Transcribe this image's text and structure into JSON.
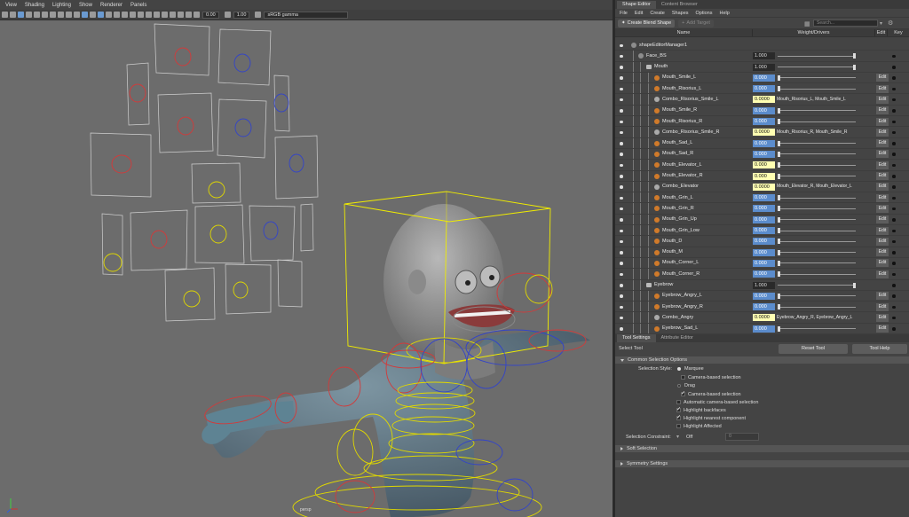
{
  "viewport": {
    "menu": [
      "View",
      "Shading",
      "Lighting",
      "Show",
      "Renderer",
      "Panels"
    ],
    "exposure": "0.00",
    "gamma": "1.00",
    "color_space": "sRGB gamma",
    "camera": "persp"
  },
  "shape_editor": {
    "tabs": [
      "Shape Editor",
      "Content Browser"
    ],
    "menu": [
      "File",
      "Edit",
      "Create",
      "Shapes",
      "Options",
      "Help"
    ],
    "create_blend_shape": "Create Blend Shape",
    "add_target": "Add Target",
    "search_placeholder": "Search...",
    "columns": {
      "name": "Name",
      "weight": "Weight/Drivers",
      "edit": "Edit",
      "key": "Key"
    },
    "edit_label": "Edit",
    "rows": [
      {
        "name": "shapeEditorManager1",
        "type": "grp",
        "depth": 0,
        "val": "",
        "drivers": "",
        "edit": false
      },
      {
        "name": "Face_BS",
        "type": "grp",
        "depth": 1,
        "val": "1.000",
        "cls": "dark",
        "knob": 1.0,
        "edit": false
      },
      {
        "name": "Mouth",
        "type": "folder",
        "depth": 2,
        "val": "1.000",
        "cls": "dark",
        "knob": 1.0,
        "edit": false
      },
      {
        "name": "Mouth_Smile_L",
        "type": "target",
        "depth": 3,
        "val": "0.000",
        "cls": "blue",
        "knob": 0,
        "edit": true
      },
      {
        "name": "Mouth_Risorius_L",
        "type": "target",
        "depth": 3,
        "val": "0.000",
        "cls": "blue",
        "knob": 0,
        "edit": true
      },
      {
        "name": "Combo_Risorius_Smile_L",
        "type": "combo",
        "depth": 3,
        "val": "0.0000",
        "cls": "yel",
        "drivers": "Mouth_Risorius_L, Mouth_Smile_L",
        "edit": true
      },
      {
        "name": "Mouth_Smile_R",
        "type": "target",
        "depth": 3,
        "val": "0.000",
        "cls": "blue",
        "knob": 0,
        "edit": true
      },
      {
        "name": "Mouth_Risorius_R",
        "type": "target",
        "depth": 3,
        "val": "0.000",
        "cls": "blue",
        "knob": 0,
        "edit": true
      },
      {
        "name": "Combo_Risorius_Smile_R",
        "type": "combo",
        "depth": 3,
        "val": "0.0000",
        "cls": "yel",
        "drivers": "Mouth_Risorius_R, Mouth_Smile_R",
        "edit": true
      },
      {
        "name": "Mouth_Sad_L",
        "type": "target",
        "depth": 3,
        "val": "0.000",
        "cls": "blue",
        "knob": 0,
        "edit": true
      },
      {
        "name": "Mouth_Sad_R",
        "type": "target",
        "depth": 3,
        "val": "0.000",
        "cls": "blue",
        "knob": 0,
        "edit": true
      },
      {
        "name": "Mouth_Elevator_L",
        "type": "target",
        "depth": 3,
        "val": "0.000",
        "cls": "yel",
        "knob": 0,
        "edit": true
      },
      {
        "name": "Mouth_Elevator_R",
        "type": "target",
        "depth": 3,
        "val": "0.000",
        "cls": "yel",
        "knob": 0,
        "edit": true
      },
      {
        "name": "Combo_Elevator",
        "type": "combo",
        "depth": 3,
        "val": "0.0000",
        "cls": "yel",
        "drivers": "Mouth_Elevator_R, Mouth_Elevator_L",
        "edit": true
      },
      {
        "name": "Mouth_Grin_L",
        "type": "target",
        "depth": 3,
        "val": "0.000",
        "cls": "blue",
        "knob": 0,
        "edit": true
      },
      {
        "name": "Mouth_Grin_R",
        "type": "target",
        "depth": 3,
        "val": "0.000",
        "cls": "blue",
        "knob": 0,
        "edit": true
      },
      {
        "name": "Mouth_Grin_Up",
        "type": "target",
        "depth": 3,
        "val": "0.000",
        "cls": "blue",
        "knob": 0,
        "edit": true
      },
      {
        "name": "Mouth_Grin_Low",
        "type": "target",
        "depth": 3,
        "val": "0.000",
        "cls": "blue",
        "knob": 0,
        "edit": true
      },
      {
        "name": "Mouth_D",
        "type": "target",
        "depth": 3,
        "val": "0.000",
        "cls": "blue",
        "knob": 0,
        "edit": true
      },
      {
        "name": "Mouth_M",
        "type": "target",
        "depth": 3,
        "val": "0.000",
        "cls": "blue",
        "knob": 0,
        "edit": true
      },
      {
        "name": "Mouth_Corner_L",
        "type": "target",
        "depth": 3,
        "val": "0.000",
        "cls": "blue",
        "knob": 0,
        "edit": true
      },
      {
        "name": "Mouth_Corner_R",
        "type": "target",
        "depth": 3,
        "val": "0.000",
        "cls": "blue",
        "knob": 0,
        "edit": true
      },
      {
        "name": "Eyebrow",
        "type": "folder",
        "depth": 2,
        "val": "1.000",
        "cls": "dark",
        "knob": 1.0,
        "edit": false
      },
      {
        "name": "Eyebrow_Angry_L",
        "type": "target",
        "depth": 3,
        "val": "0.000",
        "cls": "blue",
        "knob": 0,
        "edit": true
      },
      {
        "name": "Eyebrow_Angry_R",
        "type": "target",
        "depth": 3,
        "val": "0.000",
        "cls": "blue",
        "knob": 0,
        "edit": true
      },
      {
        "name": "Combo_Angry",
        "type": "combo",
        "depth": 3,
        "val": "0.0000",
        "cls": "yel",
        "drivers": "Eyebrow_Angry_R, Eyebrow_Angry_L",
        "edit": true
      },
      {
        "name": "Eyebrow_Sad_L",
        "type": "target",
        "depth": 3,
        "val": "0.000",
        "cls": "blue",
        "knob": 0,
        "edit": true
      }
    ]
  },
  "tool_settings": {
    "tabs": [
      "Tool Settings",
      "Attribute Editor"
    ],
    "tool_name": "Select Tool",
    "reset": "Reset Tool",
    "help": "Tool Help",
    "common_section": "Common Selection Options",
    "selection_style_label": "Selection Style:",
    "marquee": "Marquee",
    "camera_based_1": "Camera-based selection",
    "drag": "Drag",
    "camera_based_2": "Camera-based selection",
    "auto_camera": "Automatic camera-based selection",
    "backfaces": "Highlight backfaces",
    "nearest": "Highlight nearest component",
    "affected": "Highlight Affected",
    "constraint_label": "Selection Constraint:",
    "constraint_value": "Off",
    "constraint_num": "0",
    "soft_selection": "Soft Selection",
    "symmetry": "Symmetry Settings"
  }
}
